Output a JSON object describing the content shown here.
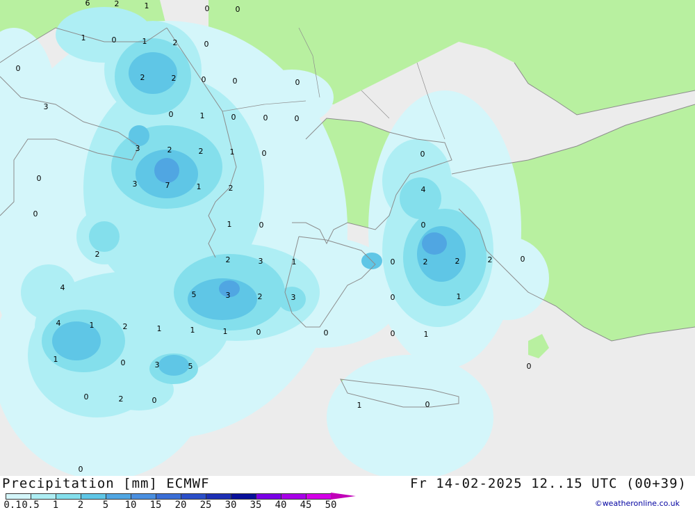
{
  "map": {
    "colors": {
      "sea": "#ececec",
      "land_other": "#b8f0a0",
      "p01": "#d4f6fa",
      "p05": "#aeeef4",
      "p1": "#84dfec",
      "p2": "#5fc6e6",
      "p5": "#50a6e2",
      "coast": "#8c8c8c"
    },
    "values": [
      {
        "text": "2"
      },
      {
        "text": "1"
      },
      {
        "text": "0"
      },
      {
        "text": "0"
      },
      {
        "text": "6"
      },
      {
        "text": "1"
      },
      {
        "text": "0"
      },
      {
        "text": "1"
      },
      {
        "text": "2"
      },
      {
        "text": "0"
      },
      {
        "text": "0"
      },
      {
        "text": "3"
      },
      {
        "text": "2"
      },
      {
        "text": "2"
      },
      {
        "text": "0"
      },
      {
        "text": "0"
      },
      {
        "text": "0"
      },
      {
        "text": "0"
      },
      {
        "text": "1"
      },
      {
        "text": "0"
      },
      {
        "text": "0"
      },
      {
        "text": "0"
      },
      {
        "text": "3"
      },
      {
        "text": "2"
      },
      {
        "text": "2"
      },
      {
        "text": "1"
      },
      {
        "text": "0"
      },
      {
        "text": "0"
      },
      {
        "text": "3"
      },
      {
        "text": "7"
      },
      {
        "text": "1"
      },
      {
        "text": "2"
      },
      {
        "text": "0"
      },
      {
        "text": "0"
      },
      {
        "text": "4"
      },
      {
        "text": "1"
      },
      {
        "text": "0"
      },
      {
        "text": "2"
      },
      {
        "text": "0"
      },
      {
        "text": "2"
      },
      {
        "text": "3"
      },
      {
        "text": "1"
      },
      {
        "text": "0"
      },
      {
        "text": "2"
      },
      {
        "text": "2"
      },
      {
        "text": "2"
      },
      {
        "text": "0"
      },
      {
        "text": "4"
      },
      {
        "text": "5"
      },
      {
        "text": "3"
      },
      {
        "text": "2"
      },
      {
        "text": "3"
      },
      {
        "text": "0"
      },
      {
        "text": "1"
      },
      {
        "text": "4"
      },
      {
        "text": "1"
      },
      {
        "text": "2"
      },
      {
        "text": "1"
      },
      {
        "text": "1"
      },
      {
        "text": "1"
      },
      {
        "text": "0"
      },
      {
        "text": "0"
      },
      {
        "text": "0"
      },
      {
        "text": "1"
      },
      {
        "text": "1"
      },
      {
        "text": "0"
      },
      {
        "text": "3"
      },
      {
        "text": "5"
      },
      {
        "text": "0"
      },
      {
        "text": "0"
      },
      {
        "text": "2"
      },
      {
        "text": "0"
      },
      {
        "text": "1"
      },
      {
        "text": "0"
      },
      {
        "text": "0"
      }
    ]
  },
  "footer": {
    "title": "Precipitation [mm] ECMWF",
    "datetime": "Fr 14-02-2025 12..15 UTC (00+39)",
    "credit": "©weatheronline.co.uk"
  },
  "legend": {
    "colors": [
      "#d4f6fa",
      "#aeeef4",
      "#84dfec",
      "#5fc6e6",
      "#50a6e2",
      "#4a8fe0",
      "#3a6ed6",
      "#2a4ec8",
      "#1c2fb4",
      "#08109a",
      "#7a00e6",
      "#a800e8",
      "#d400e8",
      "#ec00dc",
      "#c000b8"
    ],
    "ticks": [
      "0.1",
      "0.5",
      "1",
      "2",
      "5",
      "10",
      "15",
      "20",
      "25",
      "30",
      "35",
      "40",
      "45",
      "50"
    ]
  }
}
